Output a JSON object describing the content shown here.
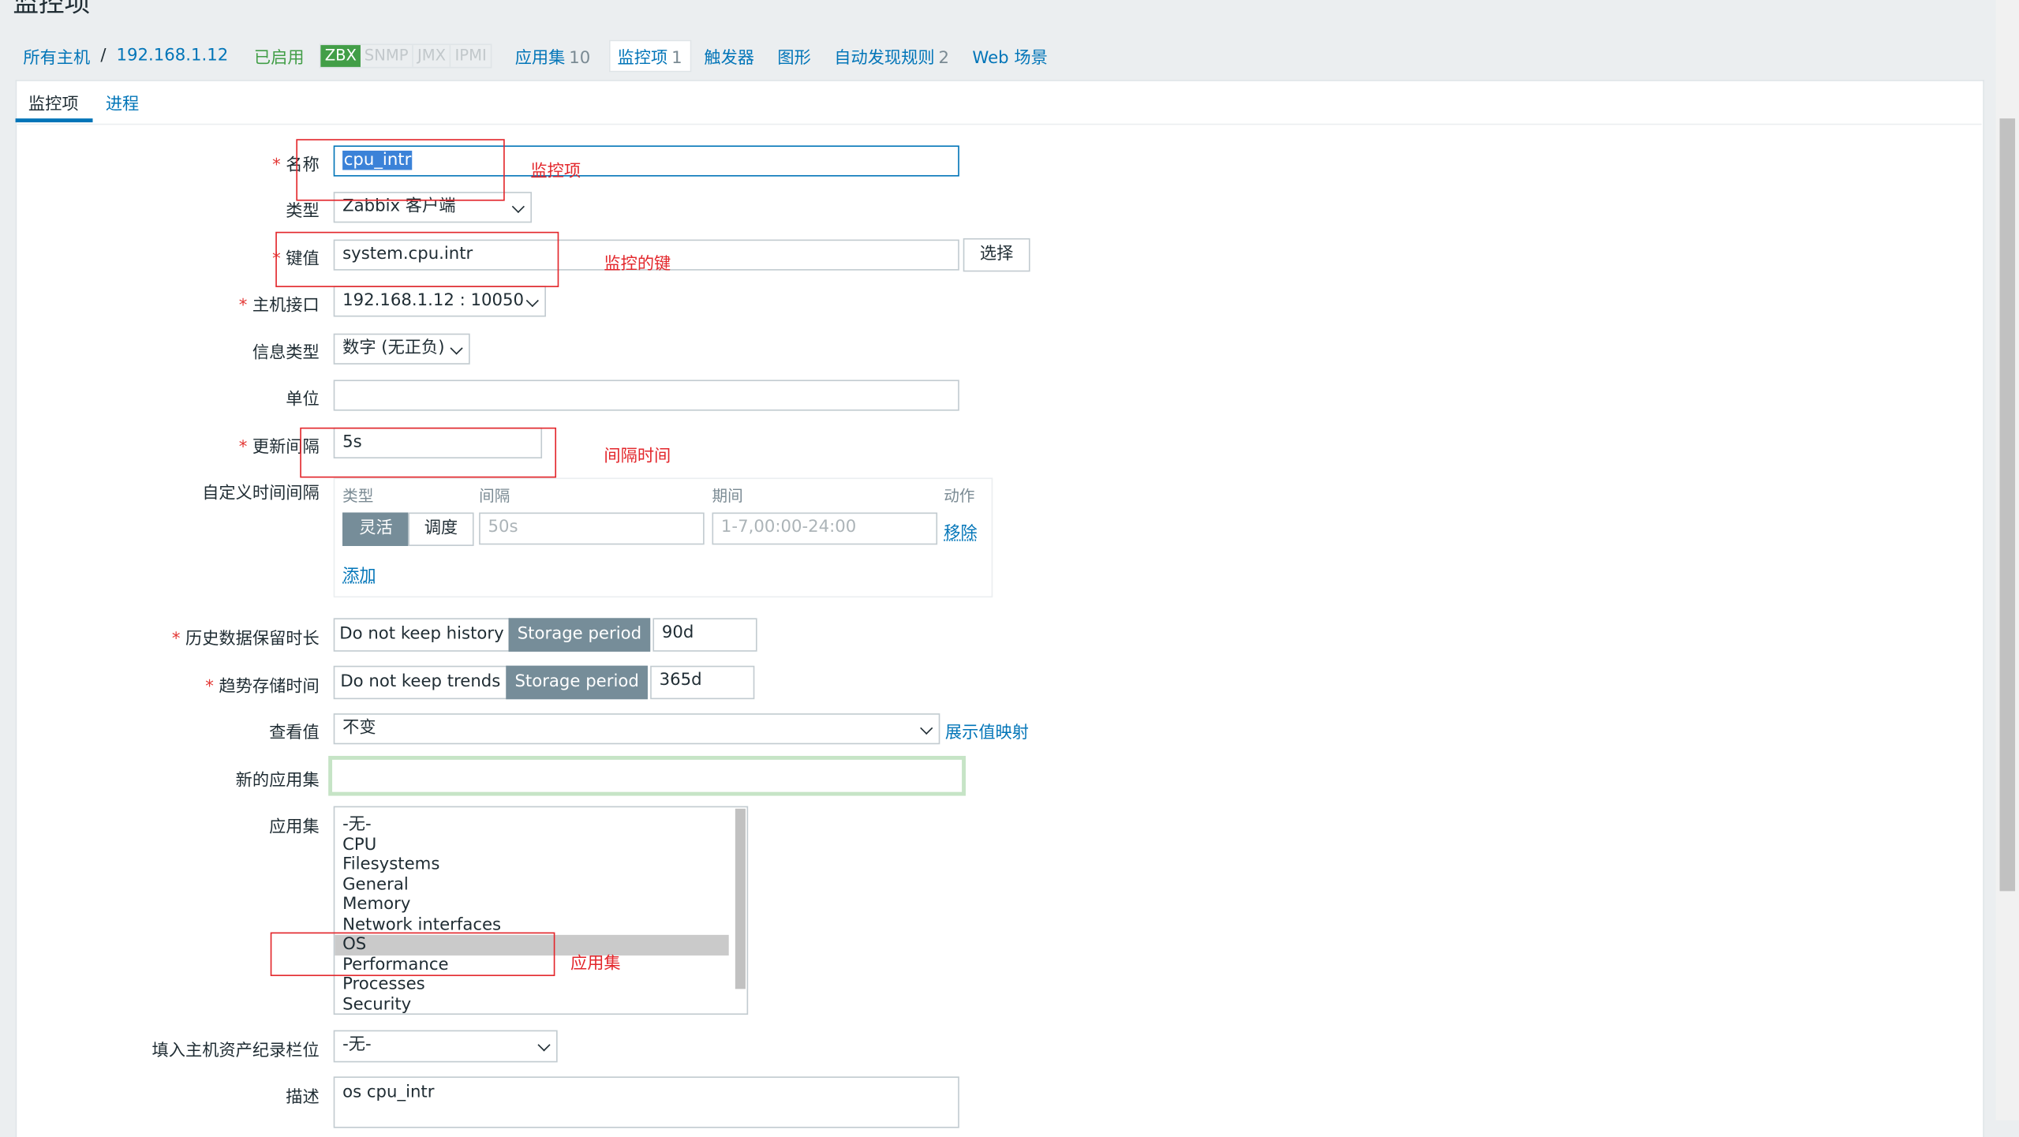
{
  "page_title": "监控项",
  "breadcrumb": {
    "all_hosts": "所有主机",
    "separator": "/",
    "host": "192.168.1.12",
    "status": "已启用"
  },
  "availability": [
    "ZBX",
    "SNMP",
    "JMX",
    "IPMI"
  ],
  "host_nav": [
    {
      "label": "应用集",
      "count": "10"
    },
    {
      "label": "监控项",
      "count": "1",
      "active": true
    },
    {
      "label": "触发器",
      "count": ""
    },
    {
      "label": "图形",
      "count": ""
    },
    {
      "label": "自动发现规则",
      "count": "2"
    },
    {
      "label": "Web 场景",
      "count": ""
    }
  ],
  "tabs": {
    "items": "监控项",
    "process": "进程"
  },
  "form": {
    "name_label": "名称",
    "name_value": "cpu_intr",
    "type_label": "类型",
    "type_value": "Zabbix 客户端",
    "key_label": "键值",
    "key_value": "system.cpu.intr",
    "key_select_button": "选择",
    "interface_label": "主机接口",
    "interface_value": "192.168.1.12 : 10050",
    "info_type_label": "信息类型",
    "info_type_value": "数字 (无正负)",
    "units_label": "单位",
    "units_value": "",
    "interval_label": "更新间隔",
    "interval_value": "5s",
    "custom_intervals_label": "自定义时间间隔",
    "custom_intervals": {
      "col_type": "类型",
      "col_interval": "间隔",
      "col_period": "期间",
      "col_action": "动作",
      "flexible": "灵活",
      "scheduling": "调度",
      "interval_placeholder": "50s",
      "period_placeholder": "1-7,00:00-24:00",
      "remove": "移除",
      "add": "添加"
    },
    "history_label": "历史数据保留时长",
    "history_no_keep": "Do not keep history",
    "history_storage": "Storage period",
    "history_value": "90d",
    "trends_label": "趋势存储时间",
    "trends_no_keep": "Do not keep trends",
    "trends_storage": "Storage period",
    "trends_value": "365d",
    "valuemap_label": "查看值",
    "valuemap_value": "不变",
    "valuemap_link": "展示值映射",
    "new_app_label": "新的应用集",
    "new_app_value": "",
    "apps_label": "应用集",
    "apps": [
      "-无-",
      "CPU",
      "Filesystems",
      "General",
      "Memory",
      "Network interfaces",
      "OS",
      "Performance",
      "Processes",
      "Security"
    ],
    "apps_selected": "OS",
    "inventory_label": "填入主机资产纪录栏位",
    "inventory_value": "-无-",
    "description_label": "描述",
    "description_value": "os cpu_intr"
  },
  "annotations": {
    "name": "监控项",
    "key": "监控的键",
    "interval": "间隔时间",
    "apps": "应用集"
  },
  "colors": {
    "link": "#0275b8",
    "enabled": "#429e47",
    "required": "#e33734",
    "annotation": "#e3262b",
    "segment_on": "#768d99"
  }
}
